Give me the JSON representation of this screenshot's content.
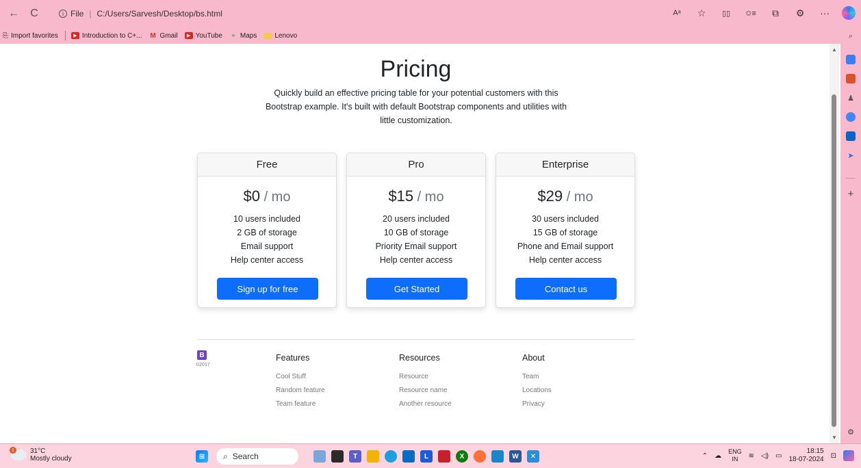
{
  "browser": {
    "back_icon": "←",
    "refresh_icon": "C",
    "address_prefix": "File",
    "address_url": "C:/Users/Sarvesh/Desktop/bs.html",
    "read_aloud_icon": "Aᵃ",
    "favorite_icon": "☆",
    "split_icon": "▯▯",
    "favorites_icon": "✩≡",
    "collections_icon": "⧉",
    "extensions_icon": "⚙",
    "more_icon": "···"
  },
  "favorites": {
    "import_label": "Import favorites",
    "items": [
      {
        "label": "Introduction to C+...",
        "icon": "youtube-icon"
      },
      {
        "label": "Gmail",
        "icon": "gmail-icon"
      },
      {
        "label": "YouTube",
        "icon": "youtube-icon"
      },
      {
        "label": "Maps",
        "icon": "maps-icon"
      },
      {
        "label": "Lenovo",
        "icon": "folder-icon"
      }
    ]
  },
  "hero": {
    "title": "Pricing",
    "lead": "Quickly build an effective pricing table for your potential customers with this Bootstrap example. It's built with default Bootstrap components and utilities with little customization."
  },
  "plans": [
    {
      "name": "Free",
      "price": "$0",
      "period": " / mo",
      "features": [
        "10 users included",
        "2 GB of storage",
        "Email support",
        "Help center access"
      ],
      "button": "Sign up for free"
    },
    {
      "name": "Pro",
      "price": "$15",
      "period": " / mo",
      "features": [
        "20 users included",
        "10 GB of storage",
        "Priority Email support",
        "Help center access"
      ],
      "button": "Get Started"
    },
    {
      "name": "Enterprise",
      "price": "$29",
      "period": " / mo",
      "features": [
        "30 users included",
        "15 GB of storage",
        "Phone and Email support",
        "Help center access"
      ],
      "button": "Contact us"
    }
  ],
  "footer": {
    "brand_letter": "B",
    "copyright": "©2017",
    "columns": [
      {
        "title": "Features",
        "links": [
          "Cool Stuff",
          "Random feature",
          "Team feature"
        ]
      },
      {
        "title": "Resources",
        "links": [
          "Resource",
          "Resource name",
          "Another resource"
        ]
      },
      {
        "title": "About",
        "links": [
          "Team",
          "Locations",
          "Privacy"
        ]
      }
    ]
  },
  "taskbar": {
    "temperature": "31°C",
    "condition": "Mostly cloudy",
    "weather_badge": "1",
    "search_label": "Search",
    "lang_top": "ENG",
    "lang_bottom": "IN",
    "time": "18:15",
    "date": "18-07-2024"
  },
  "colors": {
    "accent": "#0d6efd",
    "chrome": "#f9b9cd",
    "brand": "#6f42c1"
  }
}
